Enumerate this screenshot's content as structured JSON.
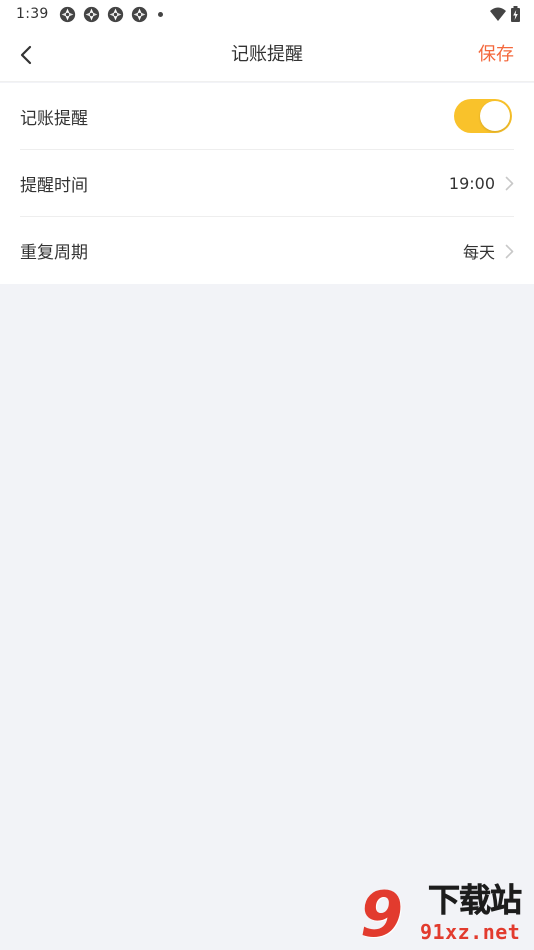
{
  "status_bar": {
    "time": "1:39",
    "notification_icons": [
      "app-notification-icon",
      "app-notification-icon",
      "app-notification-icon",
      "app-notification-icon"
    ],
    "more_indicator": "more-notifications-dot",
    "wifi": "wifi-icon",
    "battery": "battery-charging-icon"
  },
  "header": {
    "back_icon": "back-arrow-icon",
    "title": "记账提醒",
    "save_label": "保存"
  },
  "settings": {
    "reminder": {
      "label": "记账提醒",
      "enabled": true
    },
    "time": {
      "label": "提醒时间",
      "value": "19:00"
    },
    "repeat": {
      "label": "重复周期",
      "value": "每天"
    }
  },
  "watermark": {
    "logo_mark": "9",
    "text_top": "下载站",
    "text_bottom": "91xz.net"
  },
  "colors": {
    "accent": "#f4683c",
    "toggle_on": "#f9c22b",
    "background": "#f2f3f7",
    "card": "#ffffff",
    "text": "#333333",
    "watermark_red": "#e23b2e"
  }
}
